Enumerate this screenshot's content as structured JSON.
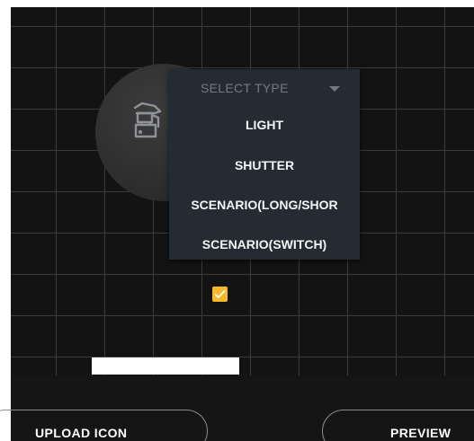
{
  "type_select": {
    "placeholder": "SELECT TYPE",
    "options": [
      {
        "label": "LIGHT"
      },
      {
        "label": "SHUTTER"
      },
      {
        "label": "SCENARIO(LONG/SHOR"
      },
      {
        "label": "SCENARIO(SWITCH)"
      }
    ]
  },
  "checkbox": {
    "checked": true
  },
  "buttons": {
    "upload_icon": "UPLOAD ICON",
    "preview": "PREVIEW"
  },
  "icons": {
    "device": "device-icon",
    "caret": "chevron-down-icon",
    "check": "check-icon"
  },
  "colors": {
    "background": "#151515",
    "grid_line": "#3b3b3b",
    "dropdown_bg": "#242b33",
    "checkbox_accent": "#f5b929",
    "placeholder_text": "#727a84",
    "button_border": "#8d8d8d"
  }
}
